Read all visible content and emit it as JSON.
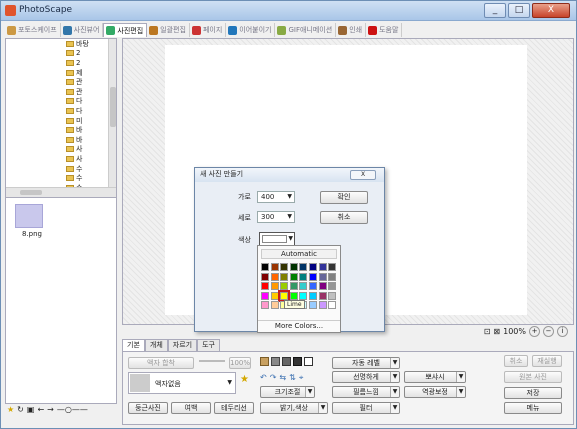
{
  "window": {
    "title": "PhotoScape",
    "buttons": [
      "_",
      "□",
      "X"
    ]
  },
  "tabs": [
    {
      "label": "포토스케이프",
      "icon": "photoscape-icon",
      "active": false
    },
    {
      "label": "사진뷰어",
      "icon": "viewer-icon",
      "active": false
    },
    {
      "label": "사진편집",
      "icon": "editor-icon",
      "active": true
    },
    {
      "label": "일괄편집",
      "icon": "batch-icon",
      "active": false
    },
    {
      "label": "페이지",
      "icon": "page-icon",
      "active": false
    },
    {
      "label": "이어붙이기",
      "icon": "combine-icon",
      "active": false
    },
    {
      "label": "GIF애니메이션",
      "icon": "gif-icon",
      "active": false
    },
    {
      "label": "인쇄",
      "icon": "print-icon",
      "active": false
    },
    {
      "label": "도움말",
      "icon": "help-icon",
      "active": false
    }
  ],
  "tree": {
    "items": [
      "바탕",
      "2",
      "2",
      "제",
      "관",
      "관",
      "다",
      "다",
      "미",
      "바",
      "바",
      "사",
      "사",
      "수",
      "수",
      "수",
      "수"
    ]
  },
  "thumbnails": [
    {
      "filename": "8.png"
    }
  ],
  "zoom": {
    "value": "100%"
  },
  "panel": {
    "tabs": [
      "기본",
      "개체",
      "자르기",
      "도구"
    ],
    "frame_button": "액자 합착",
    "frame_percent": "100%",
    "frame_select": "액자없음",
    "round_button": "둥근사진",
    "margin_button": "여백",
    "border_button": "테두리선",
    "auto_level": "자동 레벨",
    "sharpen": "선명하게",
    "backlight": "뽀샤시",
    "resize": "크기조절",
    "filmeffect": "필름느낌",
    "backlight_fix": "역광보정",
    "bright_color": "밝기,색상",
    "filter": "필터",
    "cancel": "취소",
    "redo": "재실행",
    "original": "원본 사진",
    "save": "저장",
    "menu": "메뉴"
  },
  "dialog": {
    "title": "새 사진 만들기",
    "width_label": "가로",
    "width_value": "400",
    "height_label": "세로",
    "height_value": "300",
    "color_label": "색상",
    "ok": "확인",
    "cancel": "취소"
  },
  "palette": {
    "automatic": "Automatic",
    "more": "More Colors...",
    "tooltip": "Lime",
    "selected_index": 26,
    "colors": [
      "#000000",
      "#993300",
      "#333300",
      "#003300",
      "#003366",
      "#000080",
      "#333399",
      "#333333",
      "#800000",
      "#ff6600",
      "#808000",
      "#008000",
      "#008080",
      "#0000ff",
      "#666699",
      "#808080",
      "#ff0000",
      "#ff9900",
      "#99cc00",
      "#339966",
      "#33cccc",
      "#3366ff",
      "#800080",
      "#969696",
      "#ff00ff",
      "#ffcc00",
      "#ffff00",
      "#00ff00",
      "#00ffff",
      "#00ccff",
      "#993366",
      "#c0c0c0",
      "#ff99cc",
      "#ffcc99",
      "#ffff99",
      "#ccffcc",
      "#ccffff",
      "#99ccff",
      "#cc99ff",
      "#ffffff"
    ]
  }
}
